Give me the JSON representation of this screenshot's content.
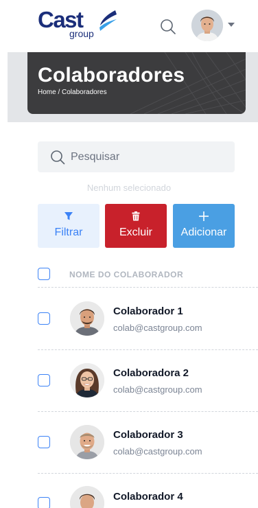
{
  "header": {
    "logo_main": "Cast",
    "logo_sub": "group",
    "search_icon": "search-icon",
    "avatar_icon": "user-avatar",
    "caret_icon": "caret-down-icon"
  },
  "banner": {
    "title": "Colaboradores",
    "breadcrumb": "Home / Colaboradores"
  },
  "search": {
    "placeholder": "Pesquisar"
  },
  "selection_status": "Nenhum selecionado",
  "actions": {
    "filter": {
      "label": "Filtrar",
      "icon": "filter-icon"
    },
    "delete": {
      "label": "Excluir",
      "icon": "trash-icon"
    },
    "add": {
      "label": "Adicionar",
      "icon": "plus-icon"
    }
  },
  "table": {
    "column_header": "NOME DO COLABORADOR",
    "rows": [
      {
        "name": "Colaborador 1",
        "email": "colab@castgroup.com"
      },
      {
        "name": "Colaboradora 2",
        "email": "colab@castgroup.com"
      },
      {
        "name": "Colaborador 3",
        "email": "colab@castgroup.com"
      },
      {
        "name": "Colaborador 4",
        "email": ""
      }
    ]
  },
  "colors": {
    "brand_navy": "#1b2e7a",
    "primary_blue": "#3b82f6",
    "delete_red": "#c8212b",
    "add_blue": "#4a9fe3"
  }
}
